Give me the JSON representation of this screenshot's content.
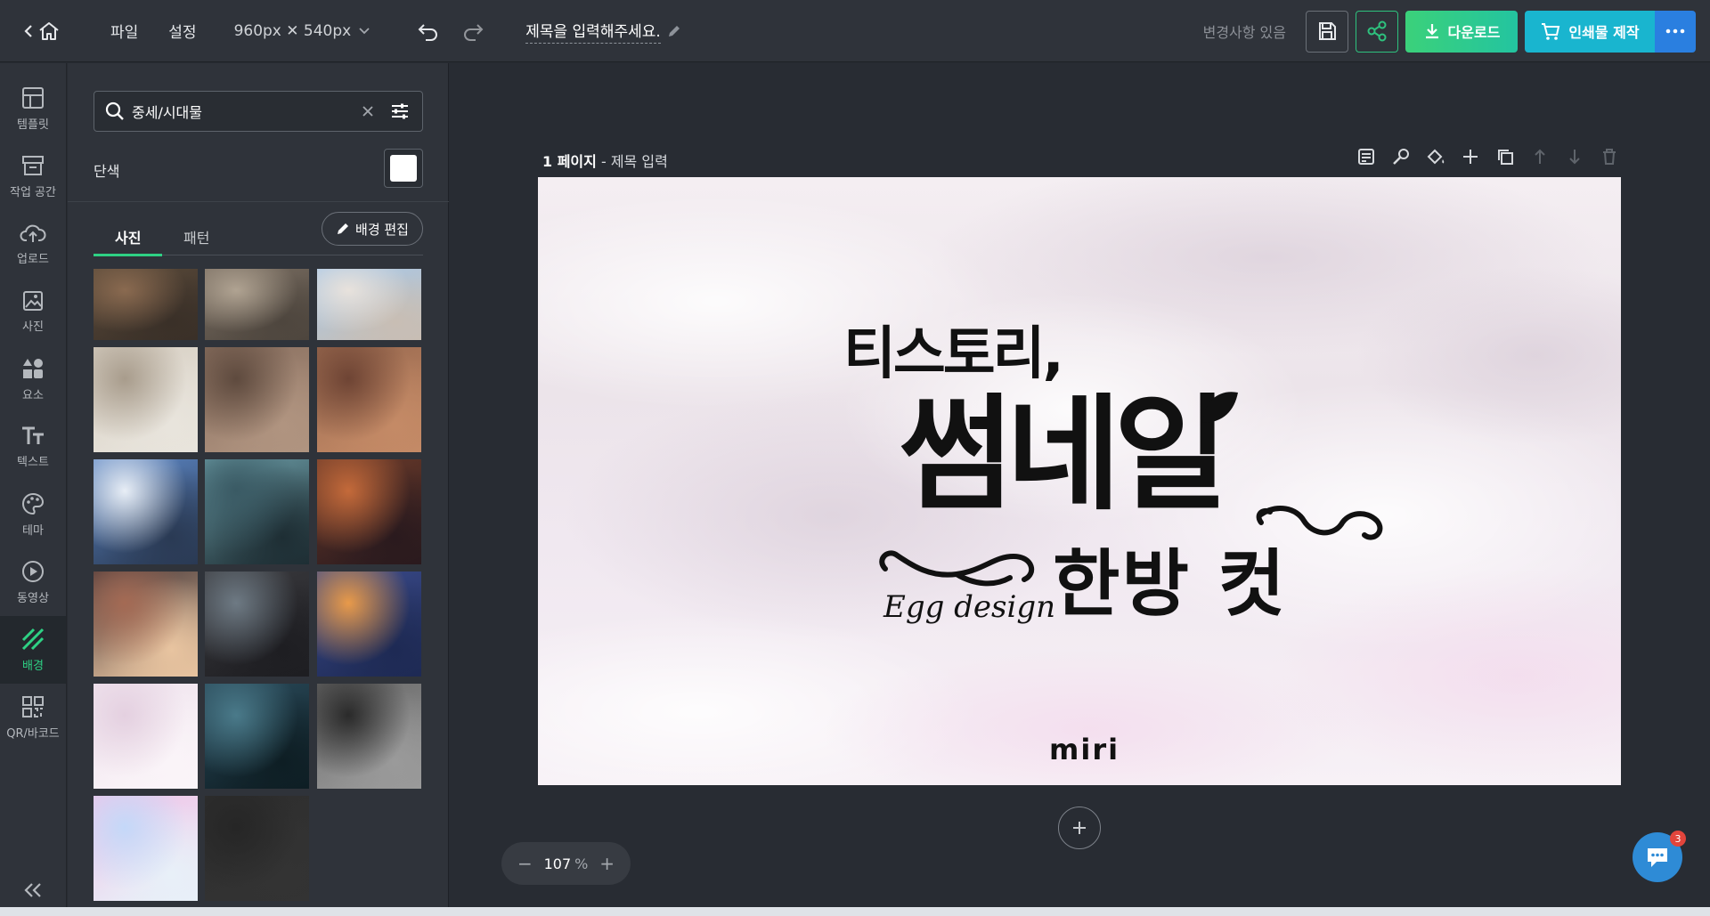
{
  "topbar": {
    "menu_file": "파일",
    "menu_settings": "설정",
    "canvas_size": "960px ✕ 540px",
    "doc_title": "제목을 입력해주세요.",
    "status": "변경사항 있음",
    "download_label": "다운로드",
    "print_label": "인쇄물 제작"
  },
  "rail": {
    "items": [
      {
        "label": "템플릿",
        "icon": "template-icon"
      },
      {
        "label": "작업 공간",
        "icon": "workspace-icon"
      },
      {
        "label": "업로드",
        "icon": "upload-icon"
      },
      {
        "label": "사진",
        "icon": "photo-icon"
      },
      {
        "label": "요소",
        "icon": "elements-icon"
      },
      {
        "label": "텍스트",
        "icon": "text-icon"
      },
      {
        "label": "테마",
        "icon": "theme-icon"
      },
      {
        "label": "동영상",
        "icon": "video-icon"
      },
      {
        "label": "배경",
        "icon": "background-icon",
        "active": true
      },
      {
        "label": "QR/바코드",
        "icon": "qr-icon"
      }
    ]
  },
  "panel": {
    "search_value": "중세/시대물",
    "solid_label": "단색",
    "solid_color": "#ffffff",
    "tab_photo": "사진",
    "tab_pattern": "패턴",
    "bg_edit_label": "배경 편집",
    "thumbnails": [
      {
        "name": "city-aerial",
        "colors": [
          "#5a4a3a",
          "#8a6a50",
          "#3a3028"
        ]
      },
      {
        "name": "cathedral-facade",
        "colors": [
          "#7a6e62",
          "#b0a392",
          "#4e463e"
        ]
      },
      {
        "name": "white-church",
        "colors": [
          "#a8c8e8",
          "#e8e2dc",
          "#c8beb4"
        ]
      },
      {
        "name": "sagrada-towers",
        "colors": [
          "#d8d0c4",
          "#a89c8c",
          "#e8e4dc"
        ]
      },
      {
        "name": "stone-wheel",
        "colors": [
          "#8a7060",
          "#5e4a3e",
          "#b09480"
        ]
      },
      {
        "name": "gothic-arch",
        "colors": [
          "#9a6a50",
          "#6e4434",
          "#c48a66"
        ]
      },
      {
        "name": "cloud-spire",
        "colors": [
          "#5c86c4",
          "#e8eef6",
          "#2a3a54"
        ]
      },
      {
        "name": "foggy-castle",
        "colors": [
          "#6a9aa4",
          "#3a5a64",
          "#1e2e34"
        ]
      },
      {
        "name": "stained-glass",
        "colors": [
          "#6a3a2a",
          "#c46a3a",
          "#2a1a1e"
        ]
      },
      {
        "name": "church-interior",
        "colors": [
          "#4a3a3a",
          "#a46a54",
          "#e8c4a0"
        ]
      },
      {
        "name": "statue-window",
        "colors": [
          "#3a3a3e",
          "#6e7a84",
          "#1e1e22"
        ]
      },
      {
        "name": "night-river",
        "colors": [
          "#3a4a8a",
          "#e89a4a",
          "#1e2a54"
        ]
      },
      {
        "name": "pink-clouds",
        "colors": [
          "#f0e4ee",
          "#e4d0e0",
          "#faf4f8"
        ]
      },
      {
        "name": "zombie-moon",
        "colors": [
          "#2a4a5a",
          "#4a7a8a",
          "#0e1e24"
        ]
      },
      {
        "name": "dark-corridor",
        "colors": [
          "#6a6a6a",
          "#2a2a2a",
          "#9a9a9a"
        ]
      },
      {
        "name": "pastel-gradient",
        "colors": [
          "#f0c4e8",
          "#c4d8f8",
          "#e8f0f8"
        ]
      },
      {
        "name": "dark-texture",
        "colors": [
          "#2e2e2e",
          "#262626",
          "#333333"
        ]
      }
    ]
  },
  "canvas": {
    "page_number": "1 페이지",
    "page_title": "제목 입력",
    "headline_1": "티스토리,",
    "headline_2": "썸네일",
    "headline_3": "한방 컷",
    "script_text": "Egg design",
    "logo_text": "miri"
  },
  "zoom": {
    "value": "107",
    "unit": "%"
  },
  "chat": {
    "badge": "3"
  }
}
